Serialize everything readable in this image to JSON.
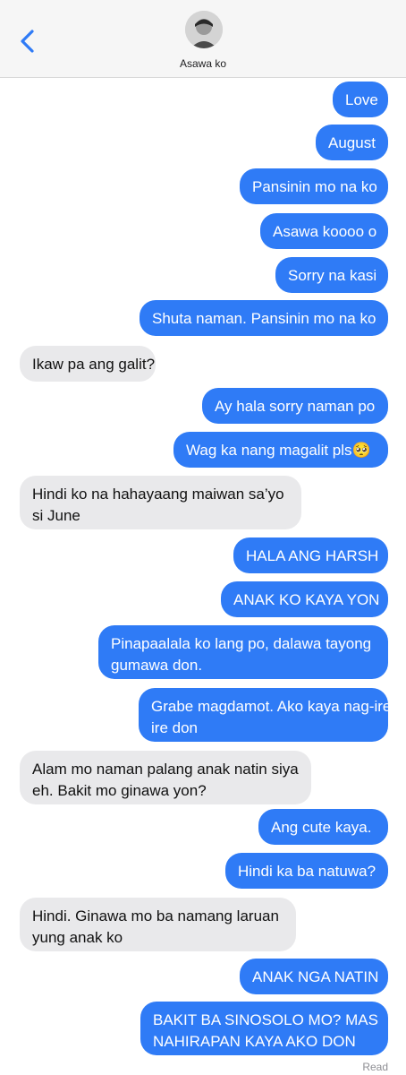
{
  "header": {
    "contact_name": "Asawa ko",
    "accent_color": "#2f7bf6",
    "back_icon": "chevron-left-icon",
    "avatar_icon": "contact-avatar"
  },
  "colors": {
    "sent_bubble": "#2f7bf6",
    "received_bubble": "#e9e9eb"
  },
  "messages": [
    {
      "from": "me",
      "lines": [
        "Love"
      ]
    },
    {
      "from": "me",
      "lines": [
        "August"
      ]
    },
    {
      "from": "me",
      "lines": [
        "Pansinin mo na ko"
      ]
    },
    {
      "from": "me",
      "lines": [
        "Asawa koooo o"
      ]
    },
    {
      "from": "me",
      "lines": [
        "Sorry na kasi"
      ]
    },
    {
      "from": "me",
      "lines": [
        "Shuta naman. Pansinin mo na ko"
      ]
    },
    {
      "from": "them",
      "lines": [
        "Ikaw pa ang galit?"
      ]
    },
    {
      "from": "me",
      "lines": [
        "Ay hala sorry naman po"
      ]
    },
    {
      "from": "me",
      "lines": [
        "Wag ka nang magalit pls🥺"
      ]
    },
    {
      "from": "them",
      "lines": [
        "Hindi ko na hahayaang maiwan sa’yo",
        "si June"
      ]
    },
    {
      "from": "me",
      "lines": [
        "HALA ANG HARSH"
      ]
    },
    {
      "from": "me",
      "lines": [
        "ANAK KO KAYA YON"
      ]
    },
    {
      "from": "me",
      "lines": [
        "Pinapaalala ko lang po, dalawa tayong",
        "gumawa don."
      ]
    },
    {
      "from": "me",
      "lines": [
        "Grabe magdamot. Ako kaya nag-ire",
        "ire don"
      ]
    },
    {
      "from": "them",
      "lines": [
        "Alam mo naman palang anak natin siya",
        "eh. Bakit mo ginawa yon?"
      ]
    },
    {
      "from": "me",
      "lines": [
        "Ang cute kaya."
      ]
    },
    {
      "from": "me",
      "lines": [
        "Hindi ka ba natuwa?"
      ]
    },
    {
      "from": "them",
      "lines": [
        "Hindi. Ginawa mo ba namang laruan",
        "yung anak ko"
      ]
    },
    {
      "from": "me",
      "lines": [
        "ANAK NGA NATIN"
      ]
    },
    {
      "from": "me",
      "lines": [
        "BAKIT BA SINOSOLO MO? MAS",
        "NAHIRAPAN KAYA AKO DON"
      ]
    }
  ],
  "read_receipt": "Read"
}
